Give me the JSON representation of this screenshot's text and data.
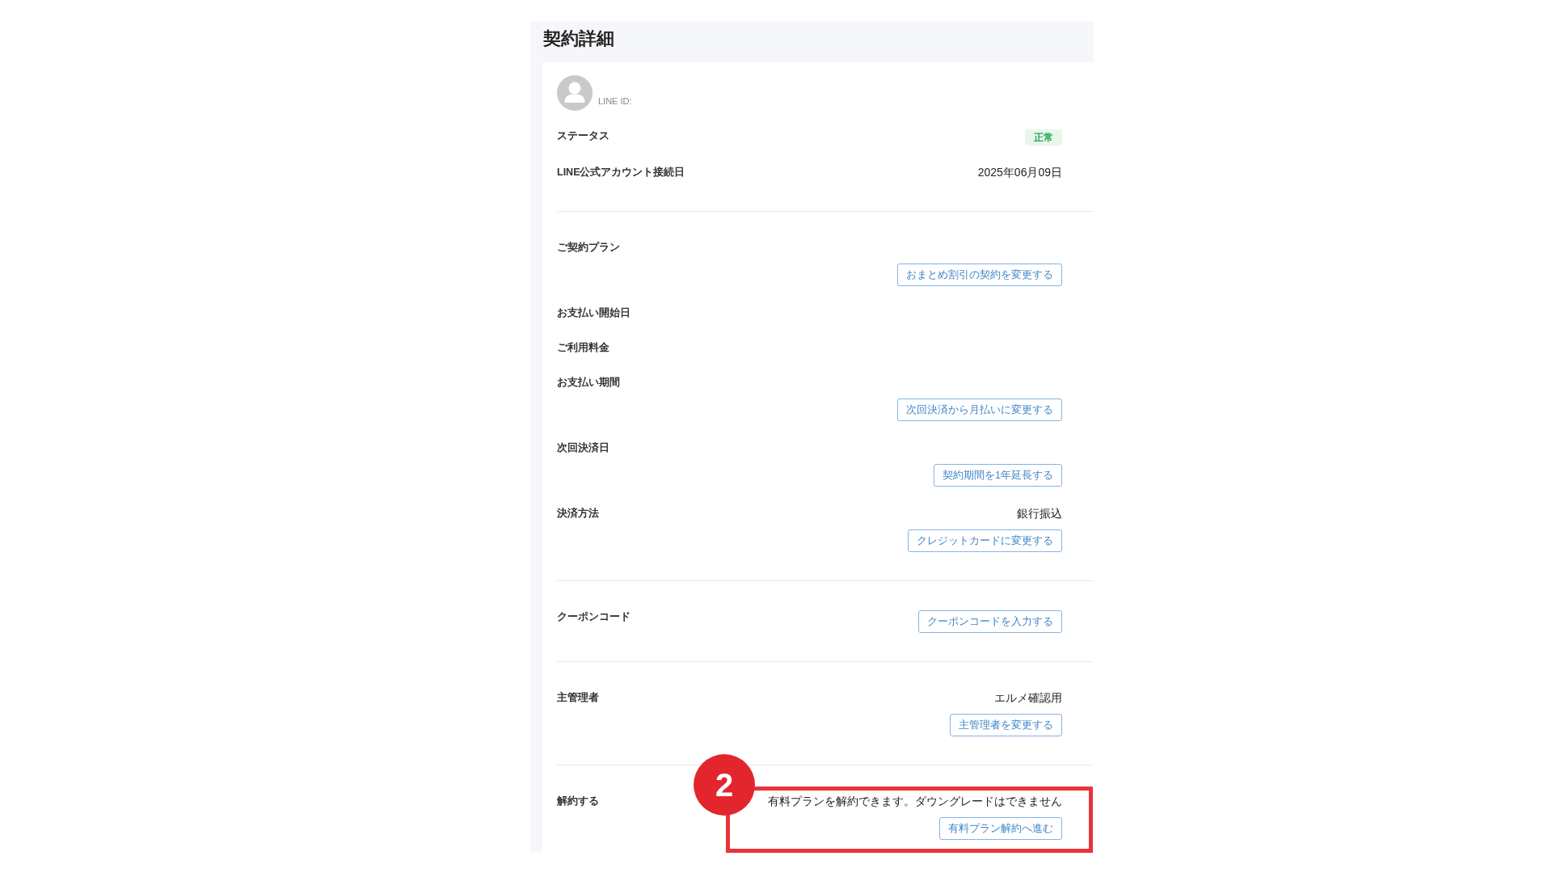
{
  "title": "契約詳細",
  "profile": {
    "id_label": "LINE ID:"
  },
  "sections": [
    {
      "rows": [
        {
          "kind": "badge",
          "label": "ステータス",
          "value": "正常"
        },
        {
          "kind": "inline",
          "label": "LINE公式アカウント接続日",
          "value": "2025年06月09日"
        }
      ]
    },
    {
      "rows": [
        {
          "kind": "stacked",
          "label": "ご契約プラン",
          "button": "おまとめ割引の契約を変更する"
        },
        {
          "kind": "inline",
          "label": "お支払い開始日"
        },
        {
          "kind": "inline",
          "label": "ご利用料金"
        },
        {
          "kind": "stacked",
          "label": "お支払い期間",
          "button": "次回決済から月払いに変更する"
        },
        {
          "kind": "stacked",
          "label": "次回決済日",
          "button": "契約期間を1年延長する"
        },
        {
          "kind": "stacked",
          "label": "決済方法",
          "value": "銀行振込",
          "button": "クレジットカードに変更する"
        }
      ]
    },
    {
      "rows": [
        {
          "kind": "inline",
          "label": "クーポンコード",
          "button": "クーポンコードを入力する"
        }
      ]
    },
    {
      "rows": [
        {
          "kind": "stacked",
          "label": "主管理者",
          "value": "エルメ確認用",
          "button": "主管理者を変更する"
        }
      ]
    },
    {
      "rows": [
        {
          "kind": "stacked",
          "label": "解約する",
          "value": "有料プランを解約できます。ダウングレードはできません",
          "button": "有料プラン解約へ進む",
          "callout": "2"
        }
      ]
    }
  ]
}
